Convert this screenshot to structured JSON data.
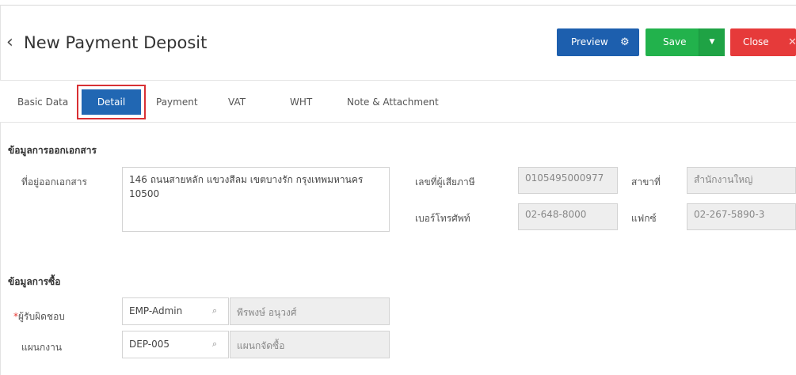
{
  "header": {
    "back_icon": "‹",
    "title": "New Payment Deposit",
    "preview_label": "Preview",
    "save_label": "Save",
    "close_label": "Close"
  },
  "tabs": [
    {
      "label": "Basic Data"
    },
    {
      "label": "Detail"
    },
    {
      "label": "Payment"
    },
    {
      "label": "VAT"
    },
    {
      "label": "WHT"
    },
    {
      "label": "Note & Attachment"
    }
  ],
  "document_section": {
    "title": "ข้อมูลการออกเอกสาร",
    "address_label": "ที่อยู่ออกเอกสาร",
    "address_value": "146 ถนนสายหลัก แขวงสีลม เขตบางรัก กรุงเทพมหานคร 10500",
    "tax_id_label": "เลขที่ผู้เสียภาษี",
    "tax_id_value": "0105495000977",
    "branch_label": "สาขาที่",
    "branch_value": "สำนักงานใหญ่",
    "phone_label": "เบอร์โทรศัพท์",
    "phone_value": "02-648-8000",
    "fax_label": "แฟกซ์",
    "fax_value": "02-267-5890-3"
  },
  "purchase_section": {
    "title": "ข้อมูลการซื้อ",
    "responsible_label": "ผู้รับผิดชอบ",
    "responsible_required": "*",
    "responsible_code": "EMP-Admin",
    "responsible_name": "พีรพงษ์ อนุวงศ์",
    "department_label": "แผนกงาน",
    "department_code": "DEP-005",
    "department_name": "แผนกจัดซื้อ"
  },
  "colors": {
    "preview": "#1d5fae",
    "save": "#22b24c",
    "close": "#e63a3a",
    "active_tab": "#2167b3",
    "highlight": "#d83034"
  }
}
